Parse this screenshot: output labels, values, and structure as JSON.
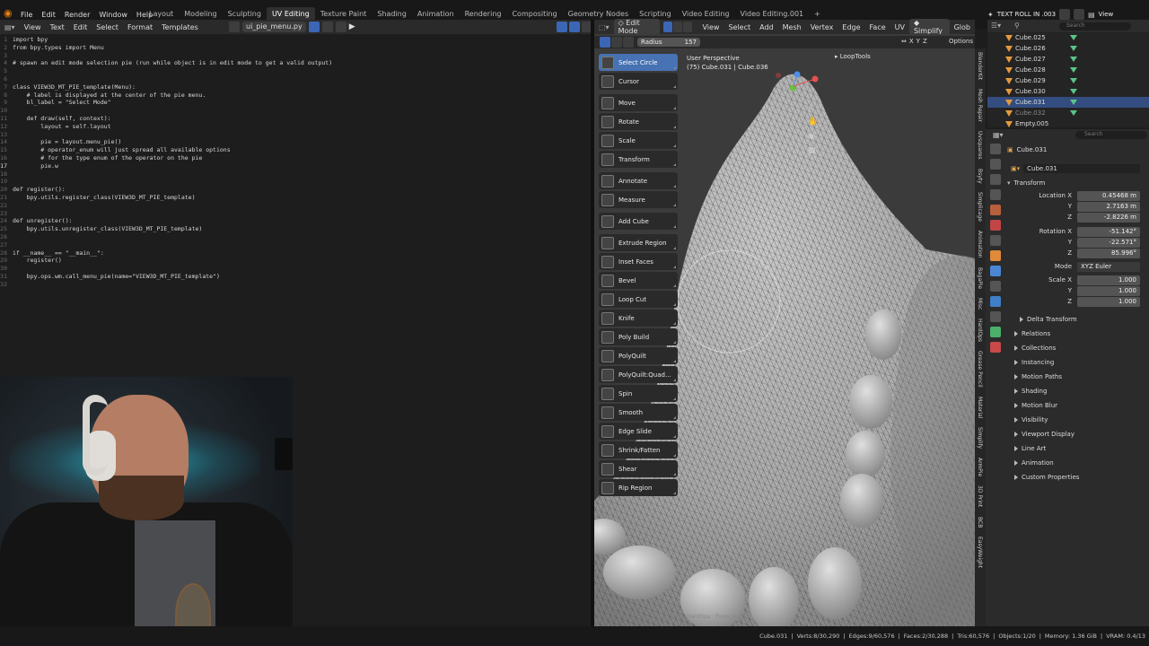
{
  "topbar": {
    "menu": [
      "File",
      "Edit",
      "Render",
      "Window",
      "Help"
    ],
    "workspaces": [
      "Layout",
      "Modeling",
      "Sculpting",
      "UV Editing",
      "Texture Paint",
      "Shading",
      "Animation",
      "Rendering",
      "Compositing",
      "Geometry Nodes",
      "Scripting",
      "Video Editing",
      "Video Editing.001"
    ],
    "active_workspace": "UV Editing",
    "scene_name": "TEXT ROLL IN .003",
    "view_layer": "View"
  },
  "text_editor": {
    "menu": [
      "View",
      "Text",
      "Edit",
      "Select",
      "Format",
      "Templates"
    ],
    "filename": "ui_pie_menu.py",
    "current_line": "17",
    "lines": [
      {
        "n": "1",
        "t": "import bpy"
      },
      {
        "n": "2",
        "t": "from bpy.types import Menu"
      },
      {
        "n": "3",
        "t": ""
      },
      {
        "n": "4",
        "t": "# spawn an edit mode selection pie (run while object is in edit mode to get a valid output)"
      },
      {
        "n": "5",
        "t": ""
      },
      {
        "n": "6",
        "t": ""
      },
      {
        "n": "7",
        "t": "class VIEW3D_MT_PIE_template(Menu):"
      },
      {
        "n": "8",
        "t": "    # label is displayed at the center of the pie menu."
      },
      {
        "n": "9",
        "t": "    bl_label = \"Select Mode\""
      },
      {
        "n": "10",
        "t": ""
      },
      {
        "n": "11",
        "t": "    def draw(self, context):"
      },
      {
        "n": "12",
        "t": "        layout = self.layout"
      },
      {
        "n": "13",
        "t": ""
      },
      {
        "n": "14",
        "t": "        pie = layout.menu_pie()"
      },
      {
        "n": "15",
        "t": "        # operator_enum will just spread all available options"
      },
      {
        "n": "16",
        "t": "        # for the type enum of the operator on the pie"
      },
      {
        "n": "17",
        "t": "        pie.w"
      },
      {
        "n": "18",
        "t": ""
      },
      {
        "n": "19",
        "t": ""
      },
      {
        "n": "20",
        "t": "def register():"
      },
      {
        "n": "21",
        "t": "    bpy.utils.register_class(VIEW3D_MT_PIE_template)"
      },
      {
        "n": "22",
        "t": ""
      },
      {
        "n": "23",
        "t": ""
      },
      {
        "n": "24",
        "t": "def unregister():"
      },
      {
        "n": "25",
        "t": "    bpy.utils.unregister_class(VIEW3D_MT_PIE_template)"
      },
      {
        "n": "26",
        "t": ""
      },
      {
        "n": "27",
        "t": ""
      },
      {
        "n": "28",
        "t": "if __name__ == \"__main__\":"
      },
      {
        "n": "29",
        "t": "    register()"
      },
      {
        "n": "30",
        "t": ""
      },
      {
        "n": "31",
        "t": "    bpy.ops.wm.call_menu_pie(name=\"VIEW3D_MT_PIE_template\")"
      },
      {
        "n": "32",
        "t": ""
      }
    ]
  },
  "viewport": {
    "mode": "Edit Mode",
    "menu": [
      "View",
      "Select",
      "Add",
      "Mesh",
      "Vertex",
      "Edge",
      "Face",
      "UV"
    ],
    "overlay_menu": "Simplify",
    "extra": "Glob",
    "radius_label": "Radius",
    "radius_value": "157",
    "axes": [
      "X",
      "Y",
      "Z"
    ],
    "options_label": "Options",
    "perspective": "User Perspective",
    "object_info": "(75) Cube.031 | Cube.036",
    "looptools": "LoopTools",
    "tools": [
      {
        "label": "Select Circle",
        "active": true
      },
      {
        "label": "Cursor"
      },
      {
        "label": "Move"
      },
      {
        "label": "Rotate"
      },
      {
        "label": "Scale"
      },
      {
        "label": "Transform"
      },
      {
        "label": "Annotate"
      },
      {
        "label": "Measure"
      },
      {
        "label": "Add Cube"
      },
      {
        "label": "Extrude Region"
      },
      {
        "label": "Inset Faces"
      },
      {
        "label": "Bevel"
      },
      {
        "label": "Loop Cut"
      },
      {
        "label": "Knife"
      },
      {
        "label": "Poly Build"
      },
      {
        "label": "PolyQuilt"
      },
      {
        "label": "PolyQuilt:Quad..."
      },
      {
        "label": "Spin"
      },
      {
        "label": "Smooth"
      },
      {
        "label": "Edge Slide"
      },
      {
        "label": "Shrink/Fatten"
      },
      {
        "label": "Shear"
      },
      {
        "label": "Rip Region"
      }
    ],
    "side_tabs": [
      "BlenderKit",
      "Mesh Repair",
      "Uvsquares",
      "Bsyty",
      "Simplicage",
      "Animation",
      "BagaPie",
      "Misc",
      "HardOps",
      "Grease Pencil",
      "Material",
      "Simplify",
      "ArmPie",
      "3D Print",
      "BCB",
      "EasyWeight"
    ],
    "hint": "HardOps · Press to View"
  },
  "outliner": {
    "rows": [
      {
        "label": "Cube.025",
        "selected": false
      },
      {
        "label": "Cube.026",
        "selected": false
      },
      {
        "label": "Cube.027",
        "selected": false
      },
      {
        "label": "Cube.028",
        "selected": false
      },
      {
        "label": "Cube.029",
        "selected": false
      },
      {
        "label": "Cube.030",
        "selected": false
      },
      {
        "label": "Cube.031",
        "selected": true
      },
      {
        "label": "Cube.032",
        "selected": false
      },
      {
        "label": "Empty.005",
        "selected": false
      }
    ],
    "search_placeholder": "Search"
  },
  "properties": {
    "search_placeholder": "Search",
    "object_name": "Cube.031",
    "datablock_name": "Cube.031",
    "transform_label": "Transform",
    "location_label": "Location X",
    "location": [
      "0.45468 m",
      "2.7163 m",
      "-2.8226 m"
    ],
    "rotation_label": "Rotation X",
    "rotation": [
      "-51.142°",
      "-22.571°",
      "85.996°"
    ],
    "mode_label": "Mode",
    "mode_value": "XYZ Euler",
    "scale_label": "Scale X",
    "scale": [
      "1.000",
      "1.000",
      "1.000"
    ],
    "y_label": "Y",
    "z_label": "Z",
    "sections": [
      "Delta Transform",
      "Relations",
      "Collections",
      "Instancing",
      "Motion Paths",
      "Shading",
      "Motion Blur",
      "Visibility",
      "Viewport Display",
      "Line Art",
      "Animation",
      "Custom Properties"
    ]
  },
  "status_bar": {
    "object": "Cube.031",
    "verts": "Verts:8/30,290",
    "edges": "Edges:9/60,576",
    "faces": "Faces:2/30,288",
    "tris": "Tris:60,576",
    "objects": "Objects:1/20",
    "memory": "Memory: 1.36 GiB",
    "vram": "VRAM: 0.4/13"
  }
}
